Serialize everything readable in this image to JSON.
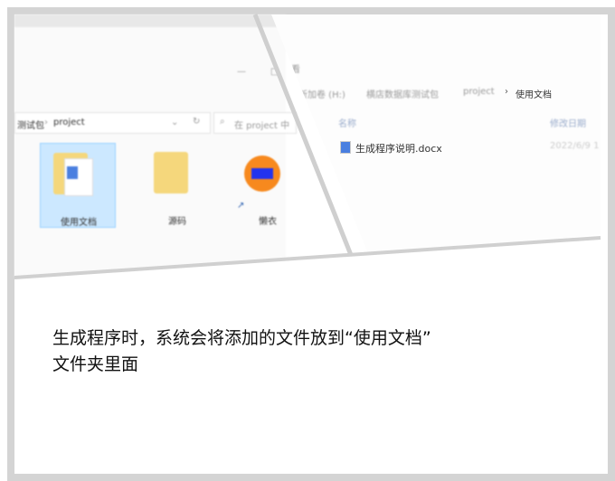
{
  "left_window": {
    "breadcrumb": [
      "测试包",
      "project"
    ],
    "search_placeholder": "在 project 中",
    "items": [
      {
        "label": "使用文档",
        "selected": true
      },
      {
        "label": "源码",
        "selected": false
      },
      {
        "label": "懒衣",
        "selected": false
      }
    ],
    "menu_label": "查看"
  },
  "right_window": {
    "breadcrumb": [
      "新加卷 (H:)",
      "横店数据库测试包",
      "project",
      "使用文档"
    ],
    "columns": [
      "名称",
      "修改日期"
    ],
    "files": [
      {
        "name": "生成程序说明.docx",
        "date": "2022/6/9 1"
      }
    ]
  },
  "caption": {
    "line1": "生成程序时，系统会将添加的文件放到“使用文档”",
    "line2": "文件夹里面"
  }
}
